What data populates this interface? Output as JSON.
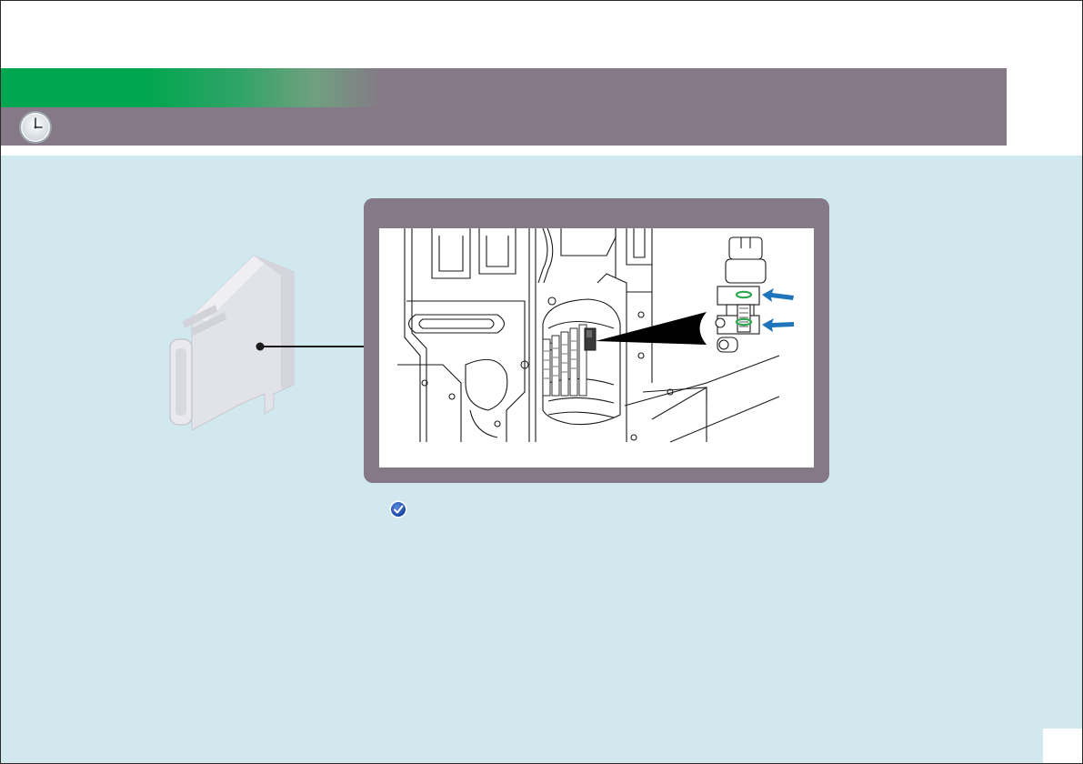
{
  "colors": {
    "header_band": "#857987",
    "accent_green": "#00a650",
    "content_background": "#d2e8ef",
    "arrow_blue": "#1f74bb",
    "seal_ring_green": "#2fa84f"
  },
  "icons": {
    "header": "clock-icon",
    "note": "check-circle-icon",
    "callouts": "arrow-left-icon"
  },
  "page": {
    "number": ""
  }
}
